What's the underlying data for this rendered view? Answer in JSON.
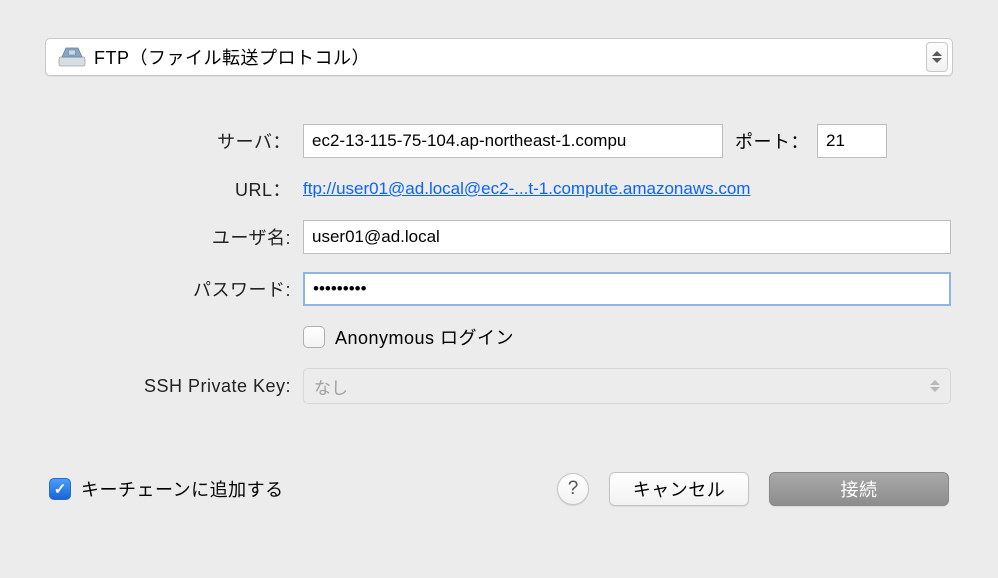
{
  "protocol": {
    "label": "FTP（ファイル転送プロトコル）"
  },
  "labels": {
    "server": "サーバ：",
    "url": "URL：",
    "port": "ポート：",
    "username": "ユーザ名:",
    "password": "パスワード:",
    "sshkey": "SSH Private Key:"
  },
  "fields": {
    "server": "ec2-13-115-75-104.ap-northeast-1.compu",
    "port": "21",
    "url_text": "ftp://user01@ad.local@ec2-...t-1.compute.amazonaws.com",
    "username": "user01@ad.local",
    "password": "•••••••••",
    "sshkey_placeholder": "なし"
  },
  "checkboxes": {
    "anonymous_label": "Anonymous ログイン",
    "keychain_label": "キーチェーンに追加する"
  },
  "buttons": {
    "help": "?",
    "cancel": "キャンセル",
    "connect": "接続"
  }
}
